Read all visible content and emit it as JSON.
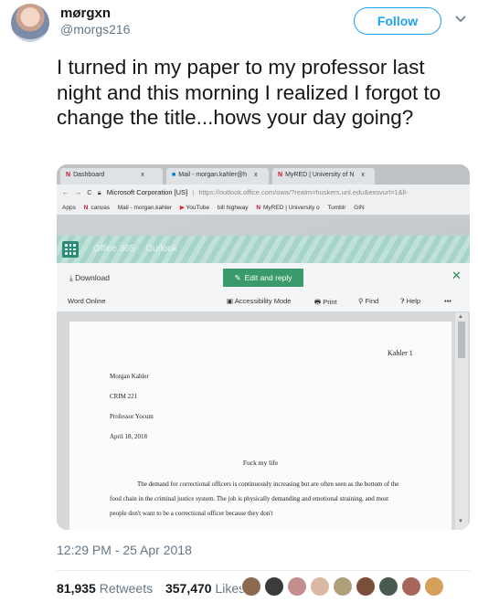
{
  "user": {
    "name": "mørgxn",
    "handle": "@morgs216",
    "follow_label": "Follow"
  },
  "tweet": {
    "text": "I turned in my paper to my professor last night and this morning I realized I forgot to change the title...hows your day going?",
    "timestamp": "12:29 PM - 25 Apr 2018",
    "retweets_count": "81,935",
    "retweets_label": "Retweets",
    "likes_count": "357,470",
    "likes_label": "Likes"
  },
  "photo": {
    "tabs": [
      {
        "label": "Dashboard",
        "close": "x"
      },
      {
        "label": "Mail - morgan.kahler@h",
        "close": "x"
      },
      {
        "label": "MyRED | University of N",
        "close": "x"
      }
    ],
    "address": {
      "secure_label": "Microsoft Corporation [US]",
      "url": "https://outlook.office.com/owa/?realm=huskers.unl.edu&exsvurl=1&ll-"
    },
    "bookmarks": [
      "Apps",
      "canvas",
      "Mail - morgan.kahler",
      "YouTube",
      "bill highway",
      "MyRED | University o",
      "Tumblr",
      "GIN"
    ],
    "o365": {
      "app": "Office 365",
      "product": "Outlook"
    },
    "toolbar": {
      "download": "Download",
      "edit_reply": "Edit and reply",
      "word_online": "Word Online",
      "accessibility": "Accessibility Mode",
      "print": "Print",
      "find": "Find",
      "help": "Help",
      "more": "•••"
    },
    "document": {
      "header_right": "Kahler 1",
      "author": "Morgan Kahler",
      "course": "CRIM 221",
      "professor": "Professor Yocum",
      "date": "April 18, 2018",
      "title": "Fuck my life",
      "body": "The demand for correctional officers is continuously increasing but are often seen as the bottom of the food chain in the criminal justice system. The job is physically demanding and emotional straining, and most people don't want to be a correctional officer because they don't"
    }
  },
  "colors": {
    "accent": "#1da1f2",
    "text": "#14171a",
    "muted": "#657786",
    "edit_green": "#3a9a6b"
  }
}
